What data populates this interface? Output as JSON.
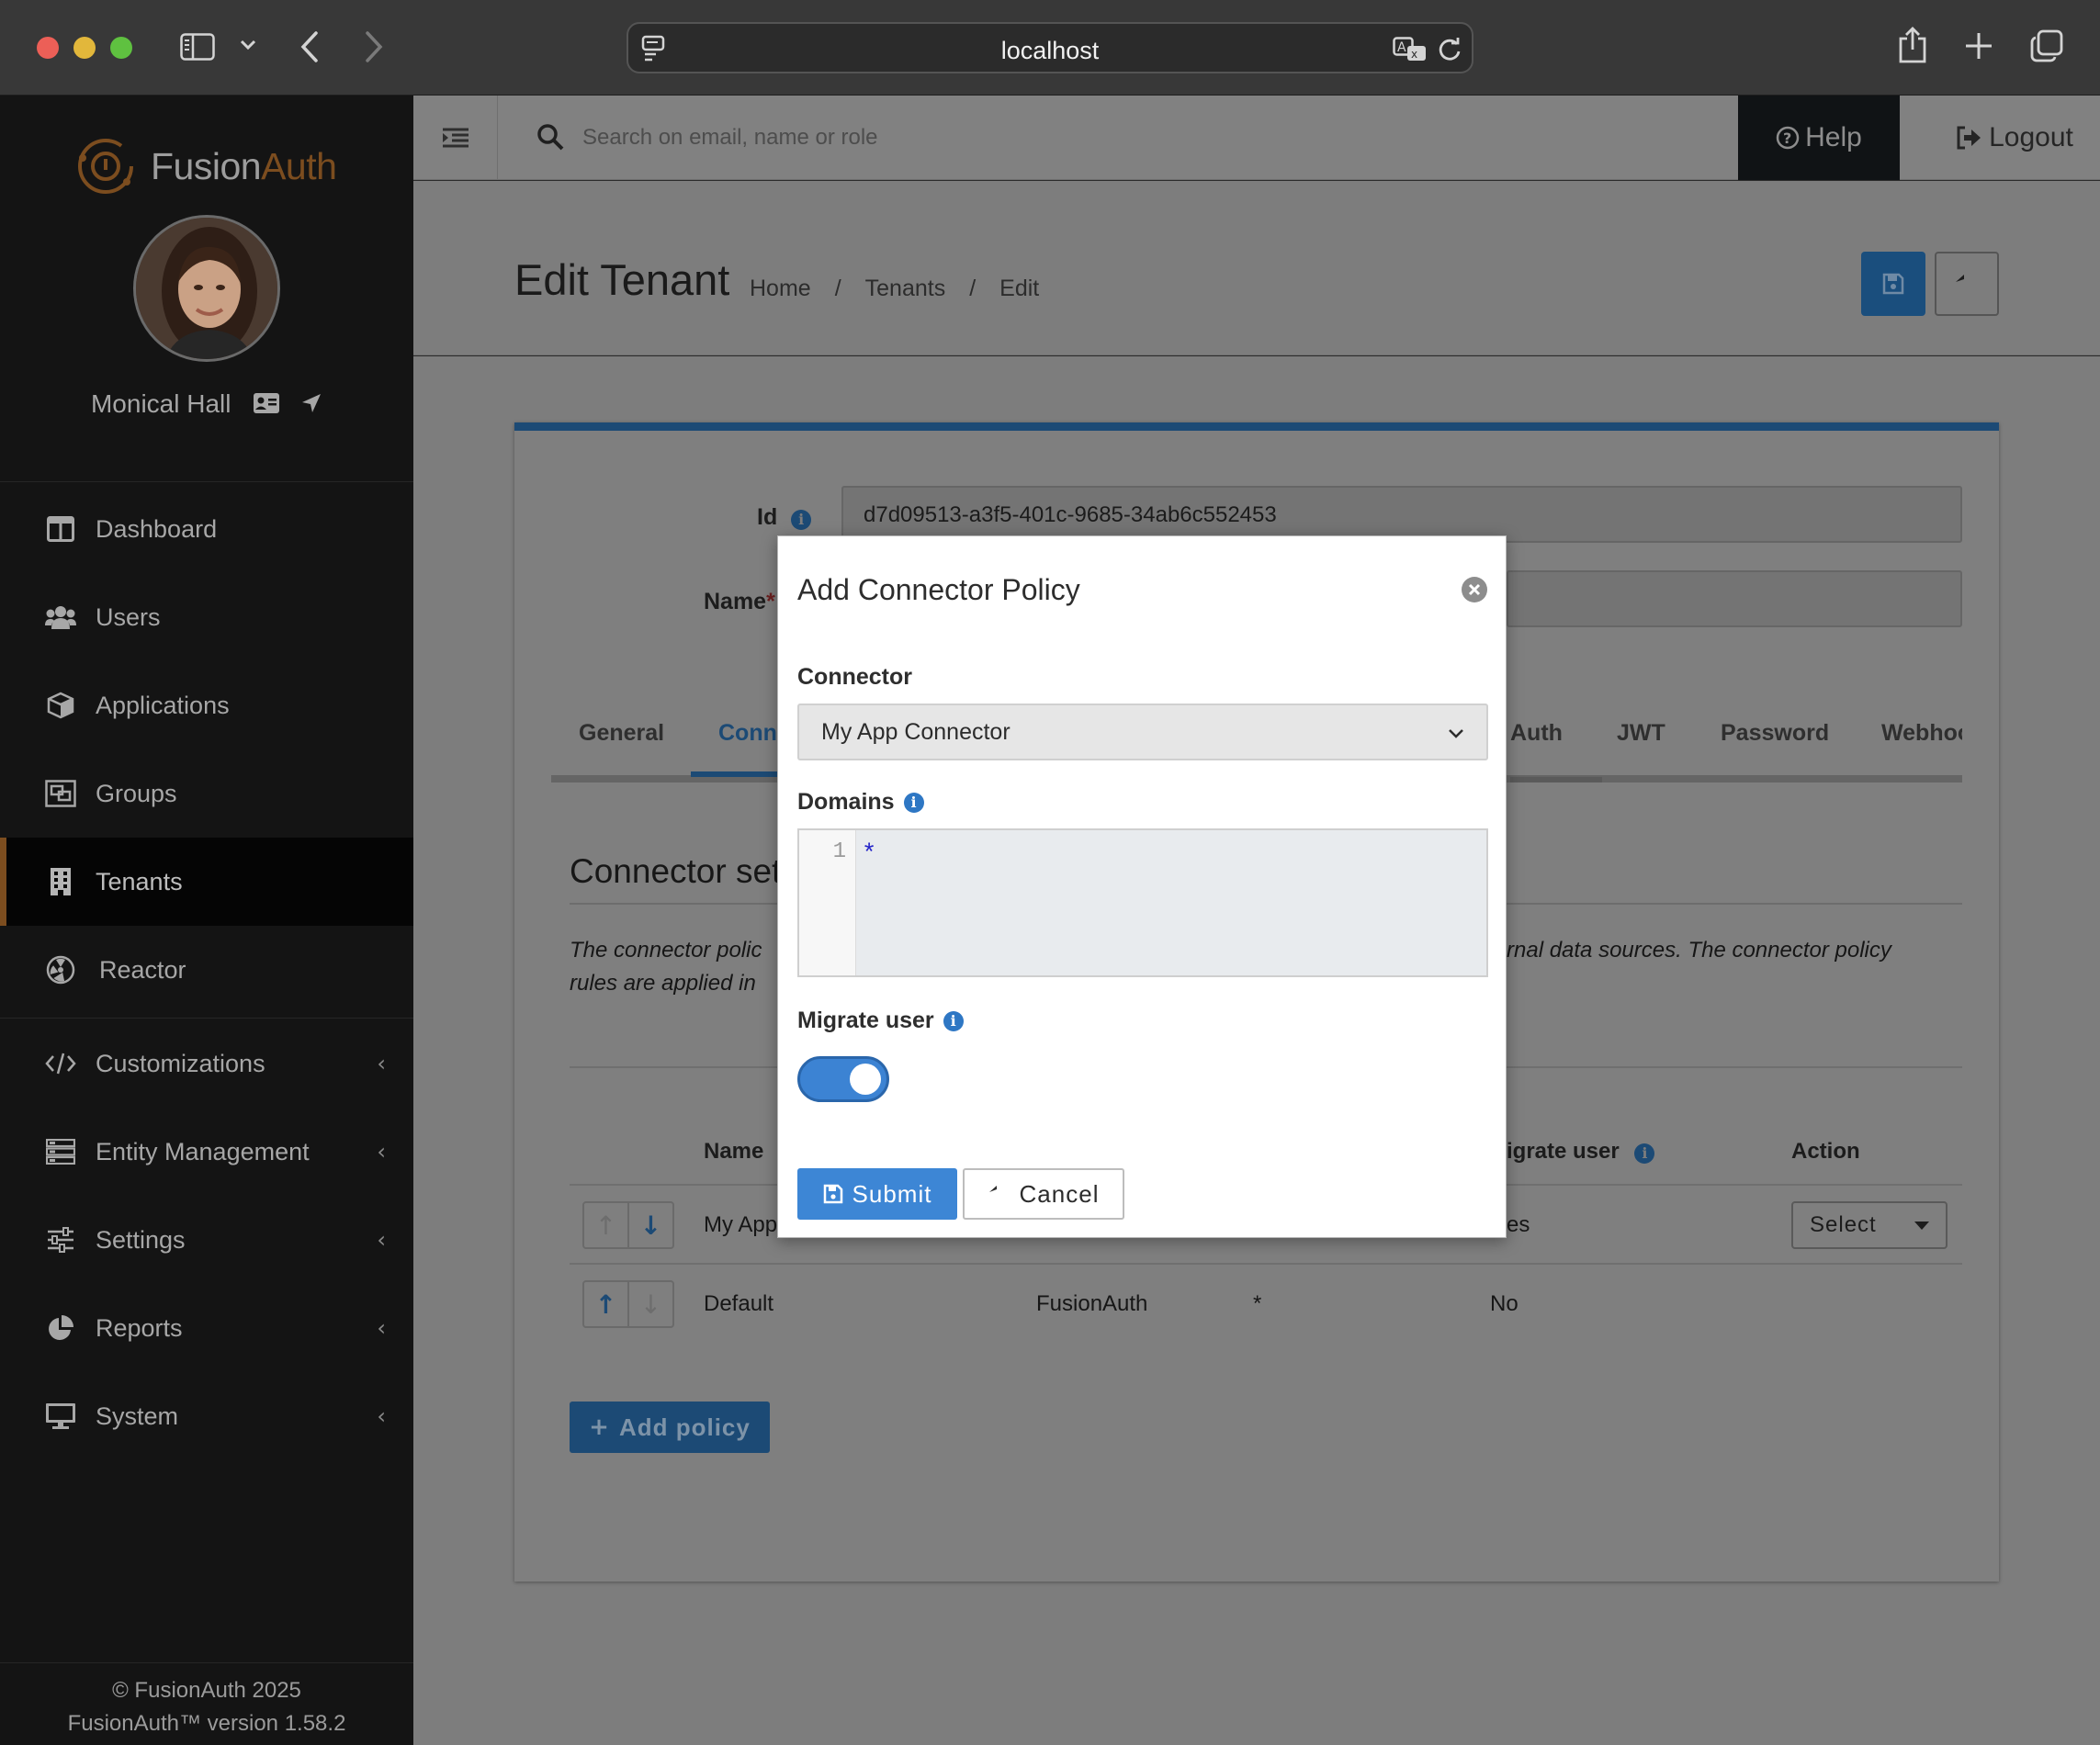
{
  "browser": {
    "url": "localhost",
    "icons": [
      "sidebar-toggle-icon",
      "chevron-down-icon",
      "back-icon",
      "forward-icon",
      "page-icon",
      "translate-icon",
      "reload-icon",
      "share-icon",
      "new-tab-icon",
      "tabs-overview-icon"
    ]
  },
  "sidebar": {
    "brand_fusion": "Fusion",
    "brand_auth": "Auth",
    "user_name": "Monical Hall",
    "nav": [
      {
        "label": "Dashboard",
        "icon": "dashboard-icon"
      },
      {
        "label": "Users",
        "icon": "users-icon"
      },
      {
        "label": "Applications",
        "icon": "applications-icon"
      },
      {
        "label": "Groups",
        "icon": "groups-icon"
      },
      {
        "label": "Tenants",
        "icon": "tenants-icon",
        "active": true
      },
      {
        "label": "Reactor",
        "icon": "reactor-icon"
      },
      {
        "label": "Customizations",
        "icon": "code-icon"
      },
      {
        "label": "Entity Management",
        "icon": "server-icon"
      },
      {
        "label": "Settings",
        "icon": "sliders-icon"
      },
      {
        "label": "Reports",
        "icon": "pie-chart-icon"
      },
      {
        "label": "System",
        "icon": "monitor-icon"
      }
    ],
    "footer_copyright": "© FusionAuth 2025",
    "footer_version": "FusionAuth™ version 1.58.2"
  },
  "topbar": {
    "search_placeholder": "Search on email, name or role",
    "help_label": "Help",
    "logout_label": "Logout"
  },
  "header": {
    "title": "Edit Tenant",
    "breadcrumb": [
      "Home",
      "Tenants",
      "Edit"
    ]
  },
  "form": {
    "id_label": "Id",
    "id_value": "d7d09513-a3f5-401c-9685-34ab6c552453",
    "name_label": "Name",
    "name_required": "*"
  },
  "tabs": [
    "General",
    "Conn",
    "Auth",
    "JWT",
    "Password",
    "Webhoo"
  ],
  "section": {
    "title": "Connector set",
    "desc_left_1": "The connector polic",
    "desc_left_2": "rules are applied in",
    "desc_right": "rnal data sources. The connector policy"
  },
  "table": {
    "headers": {
      "name": "Name",
      "migrate": "igrate user",
      "action": "Action"
    },
    "rows": [
      {
        "name": "My App",
        "connector": "",
        "domains": "",
        "migrate": "es",
        "action": "Select"
      },
      {
        "name": "Default",
        "connector": "FusionAuth",
        "domains": "*",
        "migrate": "No",
        "action": ""
      }
    ],
    "add_policy_label": "Add policy"
  },
  "modal": {
    "title": "Add Connector Policy",
    "connector_label": "Connector",
    "connector_value": "My App Connector",
    "domains_label": "Domains",
    "domains_line_number": "1",
    "domains_code": "*",
    "migrate_label": "Migrate user",
    "migrate_on": true,
    "submit_label": "Submit",
    "cancel_label": "Cancel"
  },
  "colors": {
    "accent_blue": "#3d86d5",
    "brand_orange": "#e8892e",
    "sidebar_bg": "#141414",
    "overlay_gray": "#7d7d7d"
  }
}
